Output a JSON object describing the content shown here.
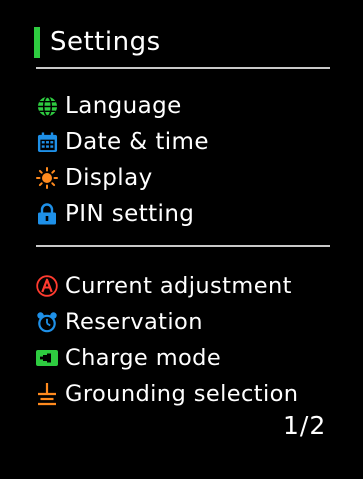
{
  "header": {
    "title": "Settings"
  },
  "menu_group_1": {
    "items": [
      {
        "label": "Language",
        "icon": "globe-icon"
      },
      {
        "label": "Date & time",
        "icon": "calendar-icon"
      },
      {
        "label": "Display",
        "icon": "sun-icon"
      },
      {
        "label": "PIN setting",
        "icon": "lock-icon"
      }
    ]
  },
  "menu_group_2": {
    "items": [
      {
        "label": "Current adjustment",
        "icon": "ampere-icon"
      },
      {
        "label": "Reservation",
        "icon": "alarm-clock-icon"
      },
      {
        "label": "Charge mode",
        "icon": "charger-plug-icon"
      },
      {
        "label": "Grounding selection",
        "icon": "ground-icon"
      }
    ]
  },
  "pagination": {
    "text": "1/2"
  },
  "colors": {
    "background": "#000000",
    "text": "#ffffff",
    "accent_green": "#2ecc40",
    "divider": "#c8c8c8",
    "icon_blue": "#1e90e8",
    "icon_orange": "#ff8a1e",
    "icon_red": "#ff3b2f"
  }
}
